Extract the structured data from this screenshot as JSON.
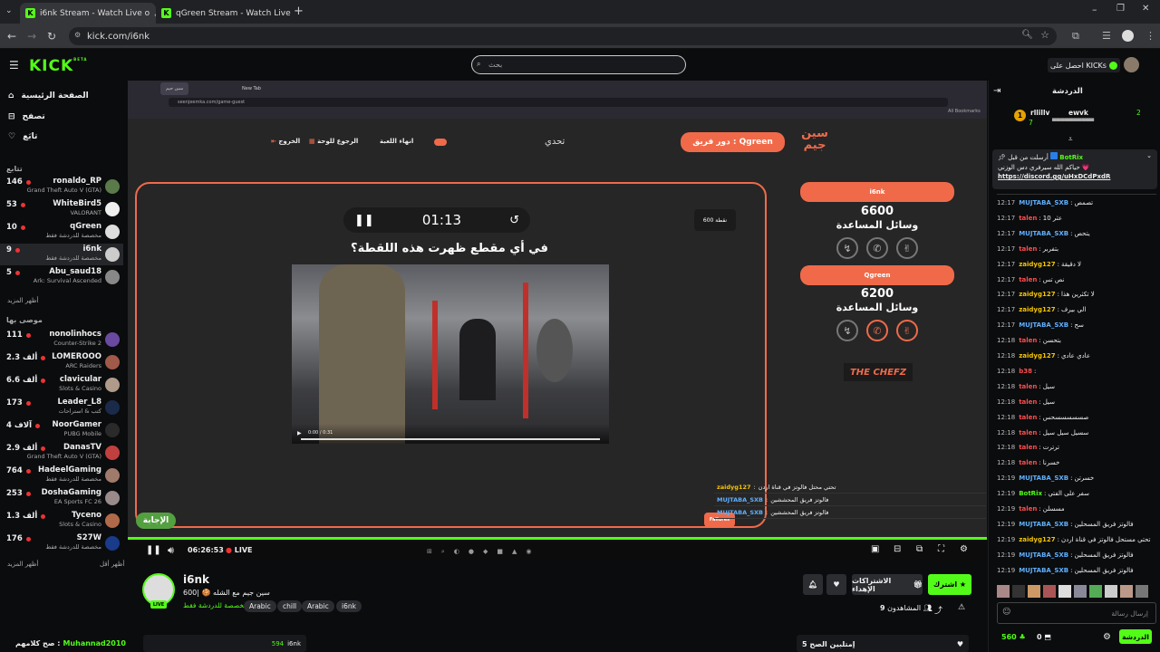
{
  "browser": {
    "tabs": [
      {
        "title": "i6nk Stream - Watch Live o",
        "active": true
      },
      {
        "title": "qGreen Stream - Watch Live o",
        "active": false
      }
    ],
    "new_tab": "+",
    "url": "kick.com/i6nk"
  },
  "header": {
    "logo": "KICK",
    "logo_sup": "BETA",
    "search_placeholder": "بحث",
    "get_kicks": "احصل على KICKs"
  },
  "sidebar": {
    "nav": [
      {
        "label": "الصفحة الرئيسية",
        "icon": "home-icon"
      },
      {
        "label": "تصفح",
        "icon": "browse-icon"
      },
      {
        "label": "تابَع",
        "icon": "heart-icon"
      }
    ],
    "following_heading": "تتابع",
    "following": [
      {
        "count": "146",
        "name": "ronaldo_RP",
        "category": "Grand Theft Auto V (GTA)",
        "selected": false
      },
      {
        "count": "53",
        "name": "WhiteBird5",
        "category": "VALORANT",
        "selected": false
      },
      {
        "count": "10",
        "name": "qGreen",
        "category": "مخصصة للدردشة فقط",
        "selected": false
      },
      {
        "count": "9",
        "name": "i6nk",
        "category": "مخصصة للدردشة فقط",
        "selected": true
      },
      {
        "count": "5",
        "name": "Abu_saud18",
        "category": "Ark: Survival Ascended",
        "selected": false
      }
    ],
    "show_more": "أظهر المزيد",
    "recommended_heading": "موصى بها",
    "recommended": [
      {
        "count": "111",
        "name": "nonolinhocs",
        "category": "Counter-Strike 2"
      },
      {
        "count": "2.3 ألف",
        "name": "LOMEROOO",
        "category": "ARC Raiders"
      },
      {
        "count": "6.6 ألف",
        "name": "clavicular",
        "category": "Slots & Casino"
      },
      {
        "count": "173",
        "name": "Leader_L8",
        "category": "كتب & استراحات"
      },
      {
        "count": "4 آلاف",
        "name": "NoorGamer",
        "category": "PUBG Mobile"
      },
      {
        "count": "2.9 ألف",
        "name": "DanasTV",
        "category": "Grand Theft Auto V (GTA)"
      },
      {
        "count": "764",
        "name": "HadeelGaming",
        "category": "مخصصة للدردشة فقط"
      },
      {
        "count": "253",
        "name": "DoshaGaming",
        "category": "EA Sports FC 26"
      },
      {
        "count": "1.3 ألف",
        "name": "Tyceno",
        "category": "Slots & Casino"
      },
      {
        "count": "176",
        "name": "S27W",
        "category": "مخصصة للدردشة فقط"
      }
    ],
    "show_more_2": "أظهر المزيد",
    "show_less": "أظهر أقل"
  },
  "inner_browser": {
    "tabs": [
      "سين جيم",
      "New Tab"
    ],
    "url": "seenjeemka.com/game-guest",
    "bookmarks": "All Bookmarks"
  },
  "game": {
    "controls": [
      "الخروج",
      "الرجوع للوحة",
      "انهاء اللعبة"
    ],
    "challenge": "تحدي",
    "team_turn": "دور فريق : Qgreen",
    "logo_lines": [
      "سين",
      "جيم"
    ],
    "timer": "01:13",
    "points_badge": "600 نقطة",
    "question": "في أي مقطع ظهرت هذه اللقطة؟",
    "clip_time": "0:00 / 0:31",
    "answer_btn": "الإجابة",
    "failures_btn": "Failures",
    "team1": {
      "name": "i6nk",
      "score": "6600",
      "aids_label": "وسائل المساعدة"
    },
    "team2": {
      "name": "Qgreen",
      "score": "6200",
      "aids_label": "وسائل المساعدة"
    },
    "sponsor": "THE CHEFZ",
    "overlay_chat": [
      {
        "user": "zaidyg127",
        "text": "تحتي محتل فالوتز في قناة اردن"
      },
      {
        "user": "MUJTABA_SXB",
        "text": "فالوتز فريق المحششين"
      },
      {
        "user": "MUJTABA_SXB",
        "text": "فالوتز فريق المحششين"
      }
    ]
  },
  "player": {
    "time": "06:26:53",
    "live": "LIVE",
    "progress": 1.0
  },
  "stream": {
    "channel": "i6nk",
    "title": "سين جيم مع الشله 🍪 |600",
    "category": "مخصصة للدردشة فقط",
    "tags": [
      "Arabic",
      "chill",
      "Arabic",
      "i6nk"
    ],
    "subscribe": "اشترك",
    "gift": "الاشتراكات الإهداء",
    "viewers_label": "المشاهدون",
    "viewers": "9",
    "live_badge": "LIVE",
    "top_gifters": "إمتلبين الصح 5",
    "bottom_left_user": "Muhannad2010",
    "bottom_left_prefix": "صح كلامهم :",
    "bottom_row_name": "i6nk",
    "bottom_row_count": "594"
  },
  "chat": {
    "title": "الدردشة",
    "leaderboard": [
      {
        "rank": "2",
        "name": "ewvk",
        "points": "7"
      },
      {
        "rank": "1",
        "name": "rllillv",
        "points": "7"
      }
    ],
    "pinned": {
      "author": "BotRix",
      "note": "أرسلت من قبل",
      "text": "حياكم الله سيرفري دس الوزني 💗",
      "link": "https://discord.gg/uHxDCdPxdR"
    },
    "messages": [
      {
        "time": "12:17",
        "user": "MUJTABA_SXB",
        "color": "blue",
        "text": "تصمص"
      },
      {
        "time": "12:17",
        "user": "talen",
        "color": "red",
        "text": "عثر 10"
      },
      {
        "time": "12:17",
        "user": "MUJTABA_SXB",
        "color": "blue",
        "text": "يتحص"
      },
      {
        "time": "12:17",
        "user": "talen",
        "color": "red",
        "text": "بتفربر"
      },
      {
        "time": "12:17",
        "user": "zaidyg127",
        "color": "yellow",
        "text": "لا دقيقة"
      },
      {
        "time": "12:17",
        "user": "talen",
        "color": "red",
        "text": "نص تس"
      },
      {
        "time": "12:17",
        "user": "zaidyg127",
        "color": "yellow",
        "text": "لا تكثرين هذا"
      },
      {
        "time": "12:17",
        "user": "zaidyg127",
        "color": "yellow",
        "text": "الي بيرف"
      },
      {
        "time": "12:17",
        "user": "MUJTABA_SXB",
        "color": "blue",
        "text": "سح"
      },
      {
        "time": "12:18",
        "user": "talen",
        "color": "red",
        "text": "بتحسن"
      },
      {
        "time": "12:18",
        "user": "zaidyg127",
        "color": "yellow",
        "text": "عادي عادي"
      },
      {
        "time": "12:18",
        "user": "b38",
        "color": "red",
        "text": ""
      },
      {
        "time": "12:18",
        "user": "talen",
        "color": "red",
        "text": "سيل"
      },
      {
        "time": "12:18",
        "user": "talen",
        "color": "red",
        "text": "سيل"
      },
      {
        "time": "12:18",
        "user": "talen",
        "color": "red",
        "text": "صسسسسسحس"
      },
      {
        "time": "12:18",
        "user": "talen",
        "color": "red",
        "text": "سسيل سيل سيل"
      },
      {
        "time": "12:18",
        "user": "talen",
        "color": "red",
        "text": "ترترت"
      },
      {
        "time": "12:18",
        "user": "talen",
        "color": "red",
        "text": "خسرنا"
      },
      {
        "time": "12:19",
        "user": "MUJTABA_SXB",
        "color": "blue",
        "text": "خسرتن"
      },
      {
        "time": "12:19",
        "user": "BotRix",
        "color": "green",
        "text": "سفر على الفتي"
      },
      {
        "time": "12:19",
        "user": "talen",
        "color": "red",
        "text": "مسسلن"
      },
      {
        "time": "12:19",
        "user": "MUJTABA_SXB",
        "color": "blue",
        "text": "فالوتز فريق المسحلين"
      },
      {
        "time": "12:19",
        "user": "zaidyg127",
        "color": "yellow",
        "text": "تحتي مستحل فالوتز في قناة اردن"
      },
      {
        "time": "12:19",
        "user": "MUJTABA_SXB",
        "color": "blue",
        "text": "فالوتز فريق المسحلين"
      },
      {
        "time": "12:19",
        "user": "MUJTABA_SXB",
        "color": "blue",
        "text": "فالوتز فريق المسحلين"
      }
    ],
    "input_placeholder": "إرسال رسالة",
    "points": "560",
    "count": "0",
    "send": "الدردشة"
  }
}
